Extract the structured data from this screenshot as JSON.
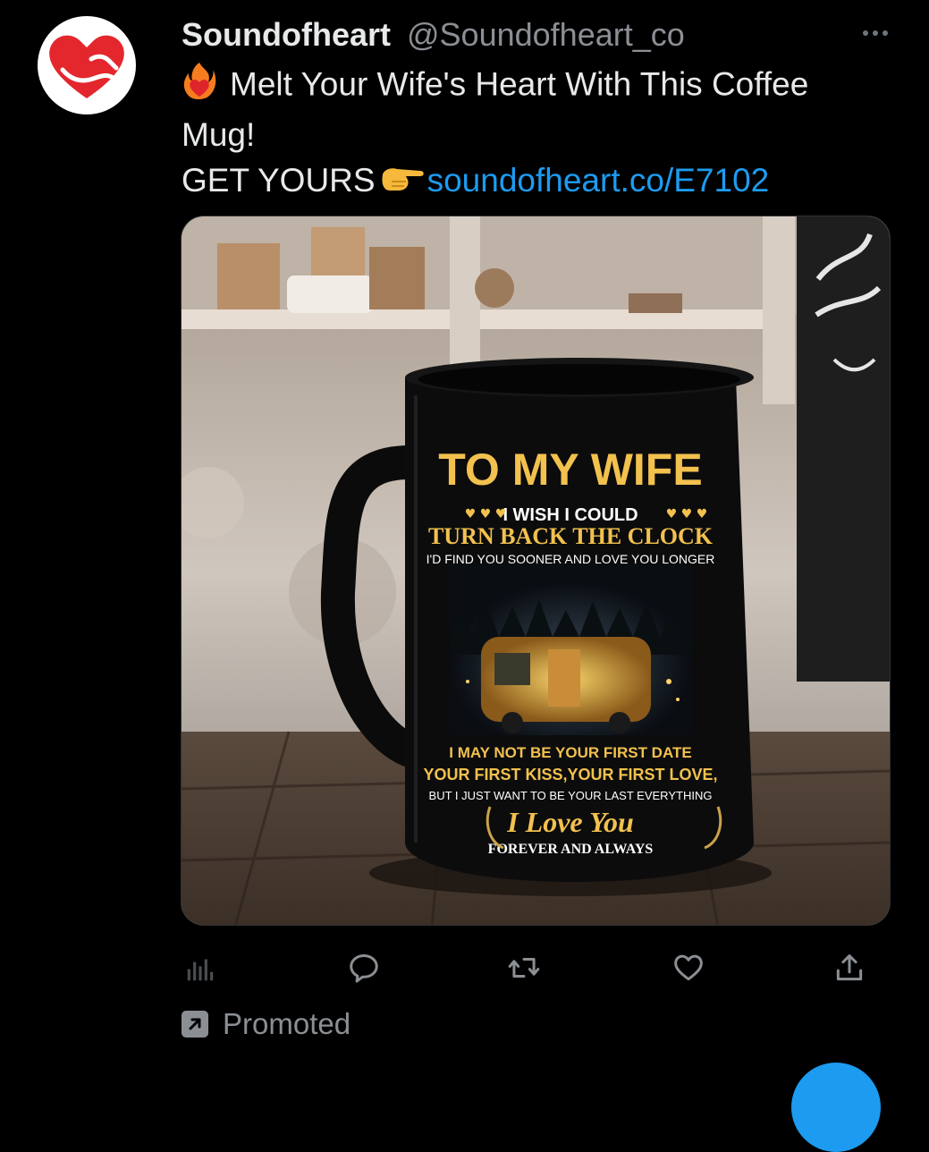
{
  "tweet": {
    "display_name": "Soundofheart",
    "handle": "@Soundofheart_co",
    "text_line1": "Melt Your Wife's Heart With This Coffee",
    "text_line2": "Mug!",
    "text_line3_prefix": "GET YOURS",
    "link_text": "soundofheart.co/E7102",
    "emoji_1": "heart-on-fire-emoji",
    "emoji_2": "backhand-index-pointing-right-emoji",
    "promoted_label": "Promoted"
  },
  "mug": {
    "title": "TO MY WIFE",
    "line1": "I WISH I COULD",
    "line2": "TURN BACK THE CLOCK",
    "line3": "I'D FIND YOU SOONER AND LOVE YOU LONGER",
    "line4": "I MAY NOT BE YOUR FIRST DATE",
    "line5": "YOUR FIRST KISS,YOUR FIRST LOVE,",
    "line6": "BUT I JUST WANT TO BE YOUR LAST EVERYTHING",
    "line7": "I Love You",
    "line8": "FOREVER AND ALWAYS"
  },
  "actions": [
    {
      "icon": "analytics-icon"
    },
    {
      "icon": "reply-icon"
    },
    {
      "icon": "retweet-icon"
    },
    {
      "icon": "like-icon"
    },
    {
      "icon": "share-icon"
    }
  ],
  "colors": {
    "background": "#000000",
    "text": "#e7e9ea",
    "muted": "#8b8f94",
    "link": "#1d9bf0",
    "brand_red": "#e3272d",
    "mug_gold": "#f2c14e"
  }
}
